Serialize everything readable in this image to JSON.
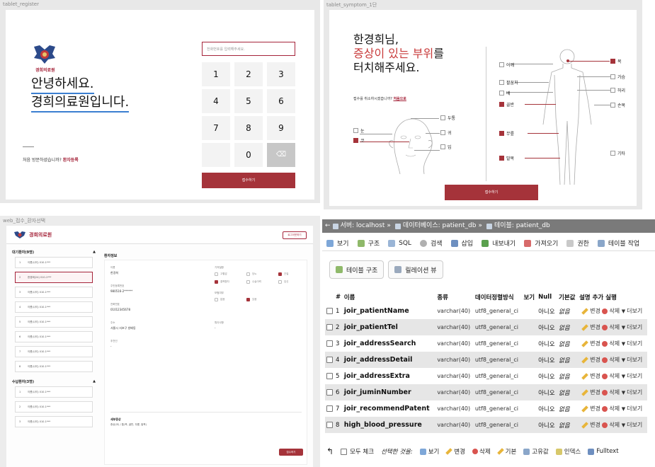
{
  "panel1": {
    "label": "tablet_register",
    "logo_text": "경희의료원",
    "greeting_line1": "안녕하세요.",
    "greeting_line2": "경희의료원입니다.",
    "first_visit_text": "처음 방문하셨습니까?",
    "first_visit_link": "환자등록",
    "phone_placeholder": "전화번호를 입력해주세요.",
    "keys": [
      "1",
      "2",
      "3",
      "4",
      "5",
      "6",
      "7",
      "8",
      "9",
      "",
      "0",
      "⌫"
    ],
    "submit_label": "접수하기"
  },
  "panel2": {
    "label": "tablet_symptom_1단",
    "title_line1": "한경희님,",
    "title_red": "증상이 있는 부위",
    "title_line2_suffix": "를",
    "title_line3": "터치해주세요.",
    "cancel_text": "접수를 취소하시겠습니까?",
    "cancel_link": "처음으로",
    "face_parts": [
      {
        "label": "두통",
        "checked": false
      },
      {
        "label": "귀",
        "checked": false
      },
      {
        "label": "입",
        "checked": false
      },
      {
        "label": "눈",
        "checked": false
      },
      {
        "label": "코",
        "checked": true
      }
    ],
    "body_left": [
      {
        "label": "어깨",
        "checked": false
      },
      {
        "label": "팔꿈치",
        "checked": false
      },
      {
        "label": "배",
        "checked": false
      },
      {
        "label": "골반",
        "checked": true
      },
      {
        "label": "무릎",
        "checked": true
      },
      {
        "label": "발목",
        "checked": true
      }
    ],
    "body_right": [
      {
        "label": "목",
        "checked": true
      },
      {
        "label": "가슴",
        "checked": false
      },
      {
        "label": "허리",
        "checked": false
      },
      {
        "label": "손목",
        "checked": false
      },
      {
        "label": "기타",
        "checked": false
      }
    ],
    "confirm_label": "접수하기"
  },
  "panel3": {
    "label": "web_접수_환자선택",
    "logo_text": "경희의료원",
    "logout_label": "로그아웃하기",
    "waiting_header": "대기환자(9명)",
    "done_header": "수납환자(3명)",
    "waiting": [
      {
        "num": "1",
        "text": "이름(나이) 010-1***"
      },
      {
        "num": "2",
        "text": "한경희(24) 010-1***"
      },
      {
        "num": "3",
        "text": "이름(나이) 010-1***"
      },
      {
        "num": "4",
        "text": "이름(나이) 010-1***"
      },
      {
        "num": "5",
        "text": "이름(나이) 010-1***"
      },
      {
        "num": "6",
        "text": "이름(나이) 010-1***"
      },
      {
        "num": "7",
        "text": "이름(나이) 010-1***"
      },
      {
        "num": "8",
        "text": "이름(나이) 010-1***"
      }
    ],
    "done": [
      {
        "num": "1",
        "text": "이름(나이) 010-1***"
      },
      {
        "num": "2",
        "text": "이름(나이) 010-1***"
      },
      {
        "num": "3",
        "text": "이름(나이) 010-1***"
      }
    ],
    "main_title": "환자정보",
    "fields": {
      "name_label": "이름",
      "name_value": "한경희",
      "jumin_label": "주민등록번호",
      "jumin_value": "980516-2******",
      "phone_label": "전화번호",
      "phone_value": "01012345678",
      "addr_label": "주소",
      "addr_value": "서울시 서초구 방배동",
      "recommend_label": "추천인",
      "recommend_value": "-",
      "history_label": "기저질환",
      "history_opts": [
        {
          "label": "고혈압",
          "checked": false
        },
        {
          "label": "당뇨",
          "checked": false
        },
        {
          "label": "간질",
          "checked": true
        },
        {
          "label": "결핵환자",
          "checked": true
        },
        {
          "label": "수술이력",
          "checked": false
        },
        {
          "label": "임신",
          "checked": false
        }
      ],
      "insurance_label": "보험여부",
      "insurance_opts": [
        {
          "label": "없음",
          "checked": false
        },
        {
          "label": "있음",
          "checked": true
        }
      ],
      "etc_label": "특이사항",
      "etc_value": "-"
    },
    "symptom_title": "세부증상",
    "symptom_value": "증상(코) / 통(목, 골반, 무릎, 발목)",
    "confirm_label": "접수하기"
  },
  "panel4": {
    "breadcrumb": [
      "서버: localhost",
      "데이터베이스: patient_db",
      "테이블: patient_db"
    ],
    "menu": [
      "보기",
      "구조",
      "SQL",
      "검색",
      "삽입",
      "내보내기",
      "가져오기",
      "권한",
      "테이블 작업"
    ],
    "subtabs": [
      "테이블 구조",
      "릴레이션 뷰"
    ],
    "headers": [
      "#",
      "이름",
      "종류",
      "데이터정렬방식",
      "보기",
      "Null",
      "기본값",
      "설명",
      "추가",
      "실행"
    ],
    "rows": [
      {
        "num": "1",
        "name": "joir_patientName",
        "type": "varchar(40)",
        "coll": "utf8_general_ci",
        "nul": "아니오",
        "def": "없음"
      },
      {
        "num": "2",
        "name": "joir_patientTel",
        "type": "varchar(40)",
        "coll": "utf8_general_ci",
        "nul": "아니오",
        "def": "없음"
      },
      {
        "num": "3",
        "name": "joir_addressSearch",
        "type": "varchar(40)",
        "coll": "utf8_general_ci",
        "nul": "아니오",
        "def": "없음"
      },
      {
        "num": "4",
        "name": "joir_addressDetail",
        "type": "varchar(40)",
        "coll": "utf8_general_ci",
        "nul": "아니오",
        "def": "없음"
      },
      {
        "num": "5",
        "name": "joir_addressExtra",
        "type": "varchar(40)",
        "coll": "utf8_general_ci",
        "nul": "아니오",
        "def": "없음"
      },
      {
        "num": "6",
        "name": "joir_juminNumber",
        "type": "varchar(40)",
        "coll": "utf8_general_ci",
        "nul": "아니오",
        "def": "없음"
      },
      {
        "num": "7",
        "name": "joir_recommendPatent",
        "type": "varchar(40)",
        "coll": "utf8_general_ci",
        "nul": "아니오",
        "def": "없음"
      },
      {
        "num": "8",
        "name": "high_blood_pressure",
        "type": "varchar(40)",
        "coll": "utf8_general_ci",
        "nul": "아니오",
        "def": "없음"
      }
    ],
    "actions": {
      "edit": "변경",
      "delete": "삭제",
      "more": "더보기"
    },
    "footer": {
      "check_all": "모두 체크",
      "with_selected": "선택한 것을:",
      "view": "보기",
      "edit": "변경",
      "delete": "삭제",
      "primary": "기본",
      "unique": "고유값",
      "index": "인덱스",
      "fulltext": "Fulltext"
    }
  },
  "colors": {
    "accent": "#a5333a",
    "highlight": "#c83a3a",
    "link_underline": "#3b7fd1"
  }
}
